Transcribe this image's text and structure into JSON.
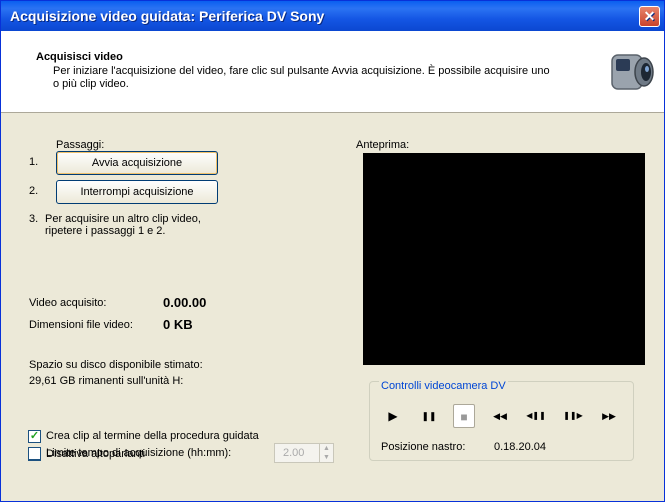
{
  "window": {
    "title": "Acquisizione video guidata: Periferica DV Sony",
    "close_glyph": "✕"
  },
  "header": {
    "title": "Acquisisci video",
    "description": "Per iniziare l'acquisizione del video, fare clic sul pulsante Avvia acquisizione. È possibile acquisire uno o più clip video.",
    "icon": "camcorder-icon"
  },
  "steps": {
    "label": "Passaggi:",
    "step1_num": "1.",
    "step2_num": "2.",
    "start_button": "Avvia acquisizione",
    "stop_button": "Interrompi acquisizione",
    "step3_num": "3.",
    "step3_text": "Per acquisire un altro clip video, ripetere i passaggi 1 e 2."
  },
  "stats": {
    "captured_label": "Video acquisito:",
    "captured_value": "0.00.00",
    "filesize_label": "Dimensioni file video:",
    "filesize_value": "0 KB",
    "space_label": "Spazio su disco disponibile stimato:",
    "space_value": "29,61 GB rimanenti sull'unità H:"
  },
  "preview": {
    "label": "Anteprima:"
  },
  "camera_controls": {
    "title": "Controlli videocamera DV",
    "buttons": [
      {
        "name": "play-icon",
        "glyph": "▶"
      },
      {
        "name": "pause-icon",
        "glyph": "❚❚"
      },
      {
        "name": "stop-icon",
        "glyph": "■"
      },
      {
        "name": "rewind-icon",
        "glyph": "◀◀"
      },
      {
        "name": "step-back-icon",
        "glyph": "◀❚❚"
      },
      {
        "name": "step-forward-icon",
        "glyph": "❚❚▶"
      },
      {
        "name": "fast-forward-icon",
        "glyph": "▶▶"
      }
    ],
    "tape_label": "Posizione nastro:",
    "tape_value": "0.18.20.04"
  },
  "options": {
    "create_clips": {
      "label": "Crea clip al termine della procedura guidata",
      "checked": true
    },
    "mute_speakers": {
      "label": "Disattiva altoparlanti",
      "checked": false
    },
    "time_limit": {
      "label": "Limite tempo di acquisizione (hh:mm):",
      "checked": false,
      "value": "2.00"
    }
  },
  "colors": {
    "title_bar": "#0b47d1",
    "dialog_bg": "#ece9d8",
    "preview_bg": "#000000",
    "group_title": "#0046d5"
  }
}
